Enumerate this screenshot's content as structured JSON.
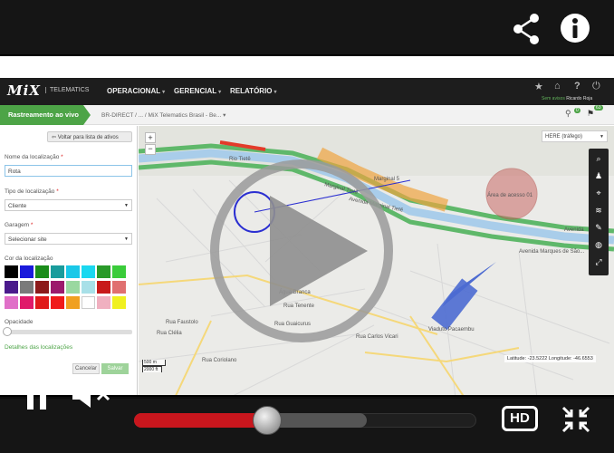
{
  "player": {
    "progress_fraction": 0.39,
    "buffered_fraction": 0.68,
    "hd_label": "HD",
    "colors": {
      "progress": "#c8161d",
      "chrome": "#151515"
    }
  },
  "app": {
    "logo": "MiX",
    "logo_sub": "TELEMATICS",
    "menu": [
      {
        "label": "OPERACIONAL"
      },
      {
        "label": "GERENCIAL"
      },
      {
        "label": "RELATÓRIO"
      }
    ],
    "user_status": "Sem avisos",
    "user_name": "Ricardo Roja",
    "notification_count": "0",
    "flag_badge": "63"
  },
  "breadcrumb": {
    "live_tab": "Rastreamento ao vivo",
    "path": "BR-DIRECT  /  ...  /  MiX Telematics Brasil - Be...  ▾"
  },
  "side_panel": {
    "back_button": "Voltar para lista de ativos",
    "location_name_label": "Nome da localização",
    "location_name_value": "Rota",
    "location_type_label": "Tipo de localização",
    "location_type_value": "Cliente",
    "garage_label": "Garagem",
    "garage_value": "Selecionar site",
    "color_label": "Cor da localização",
    "opacity_label": "Opacidade",
    "details_link": "Detalhes das localizações",
    "cancel_button": "Cancelar",
    "save_button": "Salvar",
    "swatch_colors": [
      "#000000",
      "#1a1adb",
      "#1a8c1a",
      "#1a9c9c",
      "#1ac8e8",
      "#1ad8f0",
      "#2a9a2a",
      "#3acc3a",
      "#4a1a8c",
      "#7a7a7a",
      "#8c1a1a",
      "#9c1a6c",
      "#9ad8a0",
      "#a8e0e8",
      "#c81a1a",
      "#e07070",
      "#e070c8",
      "#e01a6a",
      "#e01a1a",
      "#f01a1a",
      "#f0a020",
      "#ffffff",
      "#f0b0c0",
      "#f0f020"
    ]
  },
  "map": {
    "layer_select": "HERE (tráfego)",
    "coords": "Latitude: -23.5222  Longitude: -46.6553",
    "scale_m": "500 m",
    "scale_ft": "2000 ft",
    "zoom_in": "+",
    "zoom_out": "−",
    "labels": {
      "marginal": "Marginal Tietê",
      "avenida": "Avenida Marginal Tietê",
      "avenida_right": "Avenida",
      "marques": "Avenida Marques de São...",
      "viaduto": "Viaduto Pacaembu",
      "tiete": "Rio Tietê",
      "marginal5": "Marginal 5",
      "zone_label": "Área de acesso 01",
      "r1": "Rua Tenente",
      "r2": "Rua Guaicurus",
      "r3": "Rua Clélia",
      "r4": "Rua Coriolano",
      "r5": "Rua Faustolo",
      "r6": "Água Branca",
      "r7": "Rua Carlos Vicari"
    }
  }
}
